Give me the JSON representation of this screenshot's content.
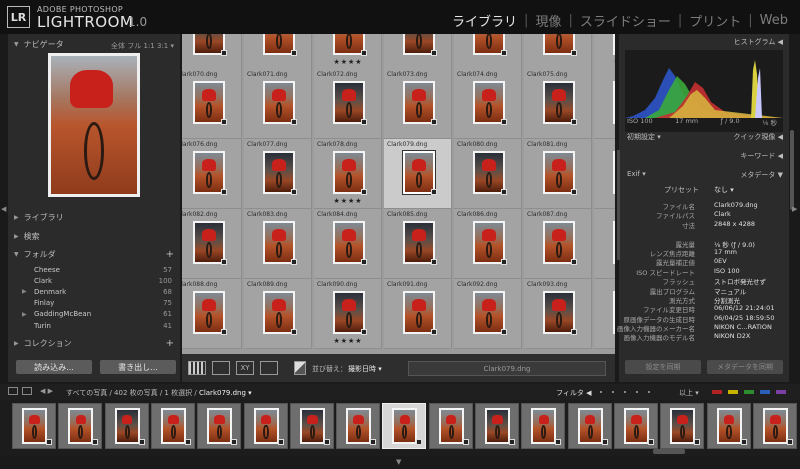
{
  "app": {
    "logo_badge": "LR",
    "brand_small": "ADOBE PHOTOSHOP",
    "brand_big": "LIGHTROOM",
    "version": "1.0",
    "modules": [
      "ライブラリ",
      "現像",
      "スライドショー",
      "プリント",
      "Web"
    ],
    "active_module": "ライブラリ"
  },
  "left_panel": {
    "navigator": {
      "title": "ナビゲータ",
      "options": "全体  フル  1:1  3:1 ▾"
    },
    "sections": {
      "library": "ライブラリ",
      "search": "検索",
      "folders": "フォルダ",
      "collections": "コレクション"
    },
    "folders": [
      {
        "name": "Cheese",
        "count": "57",
        "expander": ""
      },
      {
        "name": "Clark",
        "count": "100",
        "expander": ""
      },
      {
        "name": "Denmark",
        "count": "68",
        "expander": "▶"
      },
      {
        "name": "Finlay",
        "count": "75",
        "expander": ""
      },
      {
        "name": "GaddingMcBean",
        "count": "61",
        "expander": "▶"
      },
      {
        "name": "Turin",
        "count": "41",
        "expander": ""
      }
    ],
    "import_button": "読み込み...",
    "export_button": "書き出し..."
  },
  "grid": {
    "rows": [
      {
        "labels": [
          "",
          "",
          "",
          "",
          "",
          "",
          ""
        ],
        "stars": [
          "",
          "",
          "★★★★",
          "",
          "",
          "",
          "★★★★"
        ]
      },
      {
        "labels": [
          "Clark070.dng",
          "Clark071.dng",
          "Clark072.dng",
          "Clark073.dng",
          "Clark074.dng",
          "Clark075.dng",
          ""
        ],
        "stars": [
          "",
          "",
          "",
          "",
          "",
          "",
          ""
        ]
      },
      {
        "labels": [
          "Clark076.dng",
          "Clark077.dng",
          "Clark078.dng",
          "Clark079.dng",
          "Clark080.dng",
          "Clark081.dng",
          ""
        ],
        "stars": [
          "",
          "",
          "★★★★",
          "",
          "",
          "",
          ""
        ]
      },
      {
        "labels": [
          "Clark082.dng",
          "Clark083.dng",
          "Clark084.dng",
          "Clark085.dng",
          "Clark086.dng",
          "Clark087.dng",
          ""
        ],
        "stars": [
          "",
          "",
          "",
          "",
          "",
          "",
          ""
        ]
      },
      {
        "labels": [
          "Clark088.dng",
          "Clark089.dng",
          "Clark090.dng",
          "Clark091.dng",
          "Clark092.dng",
          "Clark093.dng",
          ""
        ],
        "stars": [
          "",
          "",
          "★★★★",
          "",
          "",
          "",
          ""
        ]
      }
    ],
    "selected": "Clark079.dng"
  },
  "toolbar": {
    "sort_label": "並び替え：",
    "sort_value": "撮影日時 ▾",
    "filename": "Clark079.dng"
  },
  "right_panel": {
    "histogram_title": "ヒストグラム ◀",
    "histo_info": {
      "iso": "ISO 100",
      "focal": "17 mm",
      "aperture": "ƒ / 9.0",
      "shutter": "⅛ 秒"
    },
    "quick_develop": {
      "left": "初期設定 ▾",
      "right": "クイック現像 ◀"
    },
    "keywords": "キーワード ◀",
    "metadata": {
      "left": "Exif ▾",
      "right": "メタデータ ▼"
    },
    "preset": {
      "label": "プリセット",
      "value": "なし ▾"
    },
    "rows": [
      {
        "k": "ファイル名",
        "v": "Clark079.dng"
      },
      {
        "k": "ファイルパス",
        "v": "Clark"
      },
      {
        "k": "寸法",
        "v": "2848 x 4288"
      },
      {
        "k": "",
        "v": ""
      },
      {
        "k": "露光量",
        "v": "⅛ 秒 (ƒ / 9.0)"
      },
      {
        "k": "レンズ焦点距離",
        "v": "17 mm"
      },
      {
        "k": "露光量補正値",
        "v": "0EV"
      },
      {
        "k": "ISO スピードレート",
        "v": "ISO 100"
      },
      {
        "k": "フラッシュ",
        "v": "ストロボ発光せず"
      },
      {
        "k": "露出プログラム",
        "v": "マニュアル"
      },
      {
        "k": "測光方式",
        "v": "分割測光"
      },
      {
        "k": "ファイル変更日時",
        "v": "06/06/12 21:24:01"
      },
      {
        "k": "原画像データの生成日時",
        "v": "06/04/25 18:59:50"
      },
      {
        "k": "画像入力機器のメーカー名",
        "v": "NIKON C…RATION"
      },
      {
        "k": "画像入力機器のモデル名",
        "v": "NIKON D2X"
      }
    ],
    "sync_settings": "設定を同期",
    "sync_metadata": "メタデータを同期"
  },
  "filmstrip": {
    "path_prefix": "すべての写真 / 402 枚の写真 / 1 枚選択 /",
    "path_file": "Clark079.dng ▾",
    "filter_label": "フィルタ ◀",
    "above_label": "以上 ▾",
    "flag_colors": [
      "#b22222",
      "#c8b400",
      "#2e8b2e",
      "#2c5fb8",
      "#7a3fa0"
    ],
    "thumb_count": 17,
    "selected_index": 8
  }
}
